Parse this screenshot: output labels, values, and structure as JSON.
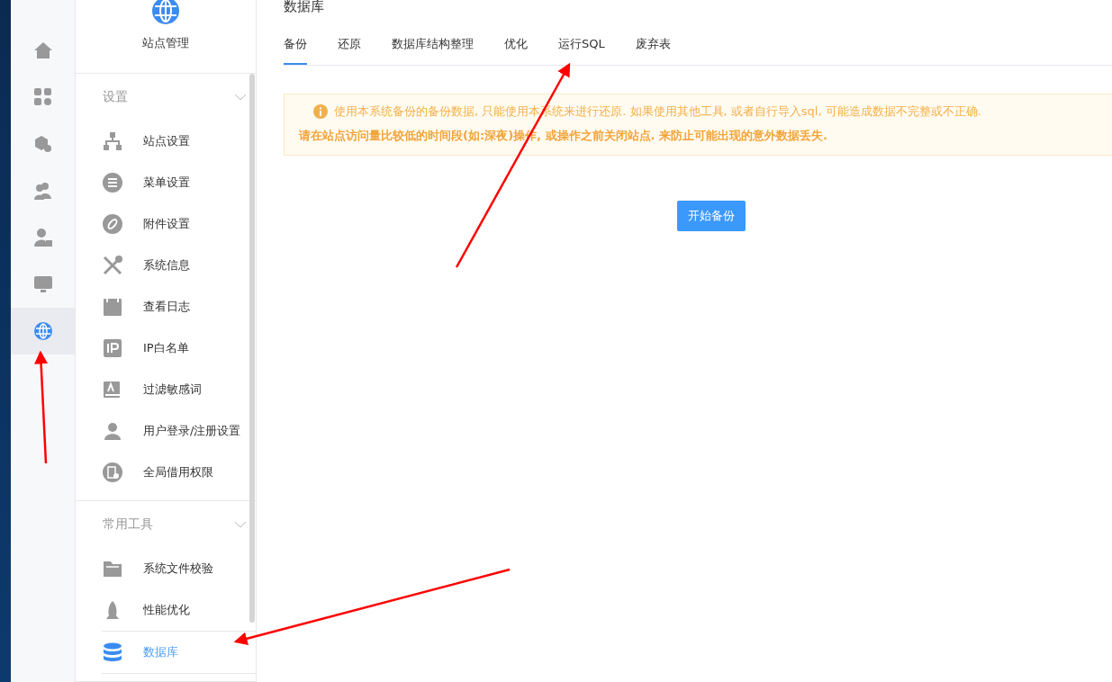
{
  "rail": [
    {
      "selected": false
    },
    {
      "selected": false
    },
    {
      "selected": false
    },
    {
      "selected": false
    },
    {
      "selected": false
    },
    {
      "selected": false
    },
    {
      "selected": true
    }
  ],
  "panel": {
    "title": "站点管理",
    "groups": [
      {
        "title": "设置",
        "items": [
          {
            "label": "站点设置",
            "selected": false
          },
          {
            "label": "菜单设置",
            "selected": false
          },
          {
            "label": "附件设置",
            "selected": false
          },
          {
            "label": "系统信息",
            "selected": false
          },
          {
            "label": "查看日志",
            "selected": false
          },
          {
            "label": "IP白名单",
            "selected": false
          },
          {
            "label": "过滤敏感词",
            "selected": false
          },
          {
            "label": "用户登录/注册设置",
            "selected": false
          },
          {
            "label": "全局借用权限",
            "selected": false
          }
        ]
      },
      {
        "title": "常用工具",
        "items": [
          {
            "label": "系统文件校验",
            "selected": false
          },
          {
            "label": "性能优化",
            "selected": false
          },
          {
            "label": "数据库",
            "selected": true
          }
        ]
      }
    ]
  },
  "main": {
    "title": "数据库",
    "tabs": [
      {
        "label": "备份",
        "selected": true
      },
      {
        "label": "还原",
        "selected": false
      },
      {
        "label": "数据库结构整理",
        "selected": false
      },
      {
        "label": "优化",
        "selected": false
      },
      {
        "label": "运行SQL",
        "selected": false
      },
      {
        "label": "废弃表",
        "selected": false
      }
    ],
    "notice": {
      "lines": [
        "使用本系统备份的备份数据, 只能使用本系统来进行还原. 如果使用其他工具, 或者自行导入sql, 可能造成数据不完整或不正确.",
        "请在站点访问量比较低的时间段(如:深夜)操作, 或操作之前关闭站点. 来防止可能出现的意外数据丢失."
      ]
    },
    "button": "开始备份"
  }
}
